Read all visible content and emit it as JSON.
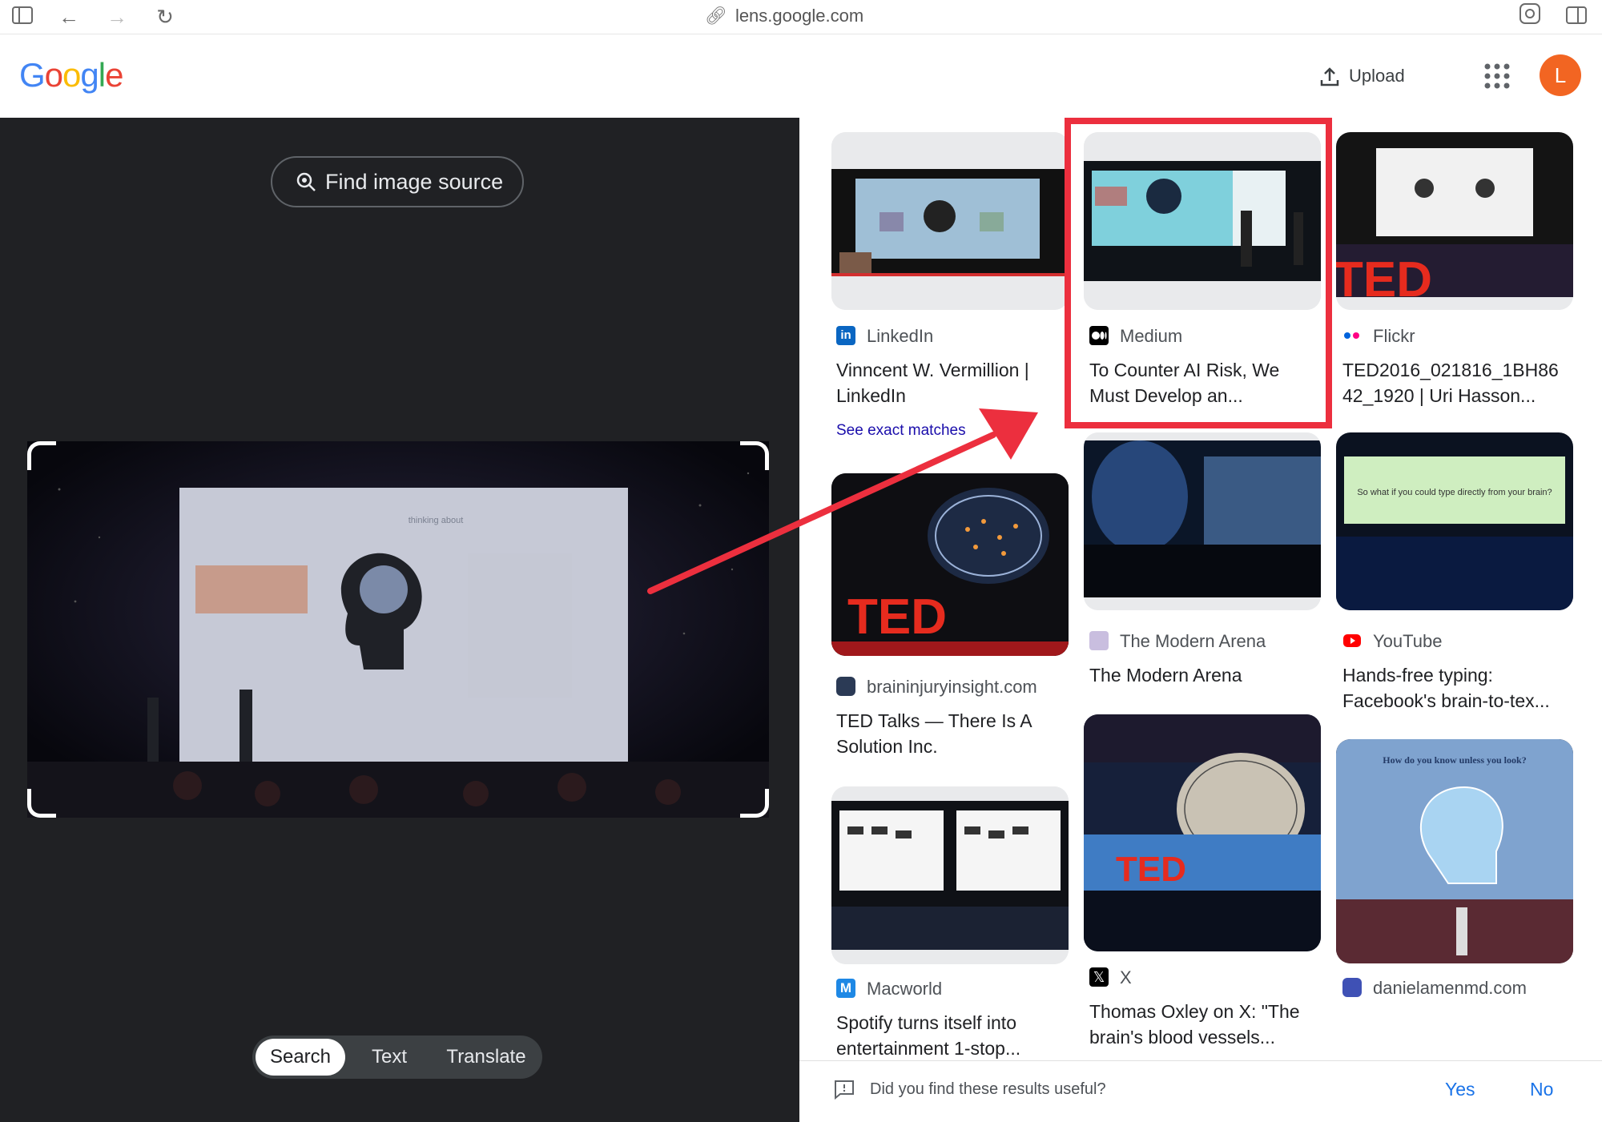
{
  "browser": {
    "url": "lens.google.com"
  },
  "header": {
    "logo_letters": [
      "G",
      "o",
      "o",
      "g",
      "l",
      "e"
    ],
    "logo_colors": [
      "#4285F4",
      "#EA4335",
      "#FBBC05",
      "#4285F4",
      "#34A853",
      "#EA4335"
    ],
    "upload_label": "Upload",
    "avatar_letter": "L"
  },
  "left": {
    "find_source_label": "Find image source",
    "modes": [
      "Search",
      "Text",
      "Translate"
    ],
    "active_mode": "Search",
    "stage_slide_text": "thinking about"
  },
  "results": [
    {
      "source": "LinkedIn",
      "title": "Vinncent W. Vermillion | LinkedIn",
      "icon": "linkedin-icon",
      "icon_color": "#0a66c2",
      "extra": "See exact matches"
    },
    {
      "source": "Medium",
      "title": "To Counter AI Risk, We Must Develop an...",
      "icon": "medium-icon",
      "icon_color": "#000000"
    },
    {
      "source": "Flickr",
      "title": "TED2016_021816_1BH8642_1920 | Uri Hasson...",
      "icon": "flickr-icon",
      "icon_color": "#ff0084"
    },
    {
      "source": "braininjuryinsight.com",
      "title": "TED Talks — There Is A Solution Inc.",
      "icon": "site-icon",
      "icon_color": "#2b3a55"
    },
    {
      "source": "The Modern Arena",
      "title": "The Modern Arena",
      "icon": "site-icon",
      "icon_color": "#c9bedf"
    },
    {
      "source": "YouTube",
      "title": "Hands-free typing: Facebook's brain-to-tex...",
      "icon": "youtube-icon",
      "icon_color": "#ff0000"
    },
    {
      "source": "Macworld",
      "title": "Spotify turns itself into entertainment 1-stop...",
      "icon": "macworld-icon",
      "icon_color": "#1e88e5"
    },
    {
      "source": "X",
      "title": "Thomas Oxley on X: \"The brain's blood vessels...",
      "icon": "x-icon",
      "icon_color": "#000000"
    },
    {
      "source": "danielamenmd.com",
      "title": "",
      "icon": "site-icon",
      "icon_color": "#3f51b5"
    }
  ],
  "thumb_texts": {
    "youtube_caption": "So what if you could type directly from your brain?",
    "daniel_caption": "How do you know unless you look?",
    "ted": "TED"
  },
  "feedback": {
    "question": "Did you find these results useful?",
    "yes": "Yes",
    "no": "No"
  },
  "colors": {
    "dark_panel": "#202124",
    "highlight_red": "#ec2f3e",
    "link_blue": "#1a73e8"
  }
}
